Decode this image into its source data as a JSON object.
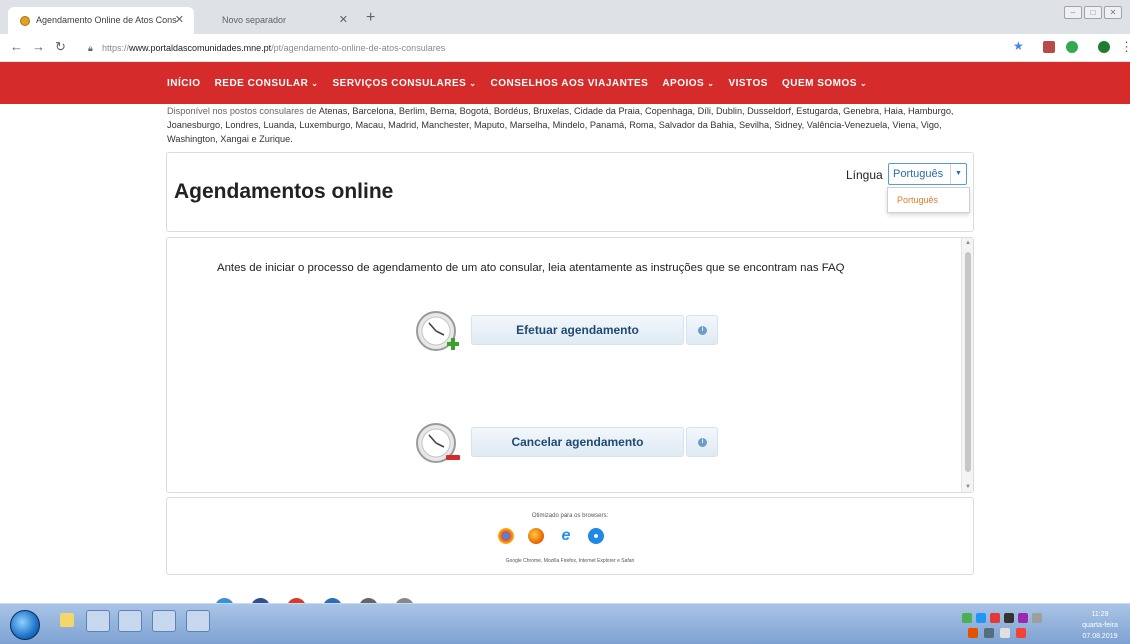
{
  "browser": {
    "tabs": [
      {
        "title": "Agendamento Online de Atos Cons­",
        "active": true
      },
      {
        "title": "Novo separador",
        "active": false
      }
    ],
    "new_tab_icon": "plus-icon",
    "url_scheme": "https://",
    "url_host": "www.portaldascomunidades.mne.pt",
    "url_path": "/pt/agendamento-online-de-atos-consulares"
  },
  "site_nav": {
    "items": [
      {
        "label": "INÍCIO",
        "has_dropdown": false
      },
      {
        "label": "REDE CONSULAR",
        "has_dropdown": true
      },
      {
        "label": "SERVIÇOS CONSULARES",
        "has_dropdown": true
      },
      {
        "label": "CONSELHOS AOS VIAJANTES",
        "has_dropdown": false
      },
      {
        "label": "APOIOS",
        "has_dropdown": true
      },
      {
        "label": "VISTOS",
        "has_dropdown": false
      },
      {
        "label": "QUEM SOMOS",
        "has_dropdown": true
      }
    ],
    "background": "#d62b2b"
  },
  "notice": {
    "intro": "Disponível nos postos consulares de ",
    "cities": "Atenas, Barcelona, Berlim, Berna, Bogotá, Bordéus, Bruxelas, Cidade da Praia, Copenhaga, Díli, Dublin, Dusseldorf, Estugarda, Genebra, Haia, Hamburgo, Joanesburgo, Londres, Luanda, Luxemburgo, Macau, Madrid, Manchester, Maputo, Marselha, Mindelo, Panamá, Roma, Salvador da Bahia, Sevilha, Sidney, Valência-Venezuela, Viena, Vigo, Washington, Xangai e Zurique."
  },
  "header": {
    "title": "Agendamentos online",
    "language_label": "Língua",
    "language_selected": "Português",
    "language_options": [
      "Português"
    ]
  },
  "main": {
    "instructions": "Antes de iniciar o processo de agendamento de um ato consular, leia atentamente as instruções que se encontram nas FAQ",
    "actions": [
      {
        "label": "Efetuar agendamento",
        "icon": "clock-add-icon"
      },
      {
        "label": "Cancelar agendamento",
        "icon": "clock-remove-icon"
      }
    ]
  },
  "footer": {
    "caption": "Otimizado para os browsers:",
    "browser_icons": [
      "chrome-icon",
      "firefox-icon",
      "internet-explorer-icon",
      "safari-icon"
    ],
    "browser_names": "Google Chrome, Mozilla Firefox, Internet Explorer e Safari"
  },
  "taskbar": {
    "time": "11:29",
    "day": "quarta-feira",
    "date": "07.08.2019"
  },
  "colors": {
    "accent_blue": "#1f4a73",
    "dropdown_option": "#e07b2c"
  }
}
